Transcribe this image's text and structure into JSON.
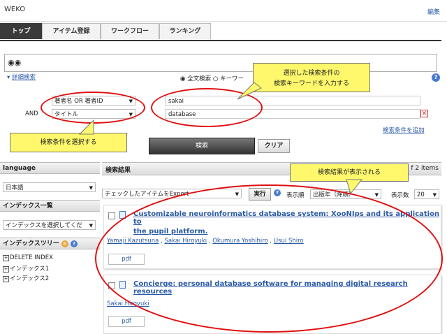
{
  "header": {
    "brand": "WEKO",
    "edit_link": "編集"
  },
  "tabs": [
    "トップ",
    "アイテム登録",
    "ワークフロー",
    "ランキング"
  ],
  "search": {
    "detail_link": "詳細検索",
    "mode_fulltext": "全文検索",
    "mode_keyword": "キーワー",
    "conditions": [
      {
        "field": "著者名 OR 著者ID",
        "value": "sakai"
      },
      {
        "operator": "AND",
        "field": "タイトル",
        "value": "database"
      }
    ],
    "add_condition": "検索条件を追加",
    "search_button": "検索",
    "clear_button": "クリア"
  },
  "sidebar": {
    "language_title": "language",
    "language_value": "日本語",
    "index_list_title": "インデックス一覧",
    "index_select_value": "インデックスを選択してくだ",
    "index_tree_title": "インデックスツリー",
    "tree": [
      "DELETE INDEX",
      "インデックス1",
      "インデックス2"
    ]
  },
  "results": {
    "title": "検索結果",
    "count_text": "f 2 items",
    "export_select": "チェックしたアイテムをExport",
    "run_button": "実行",
    "sort_label": "表示順",
    "sort_value": "出版年（降順）",
    "per_page_label": "表示数",
    "per_page_value": "20",
    "items": [
      {
        "title_line1": "Customizable neuroinformatics database system: XooNIps and its application to",
        "title_line2": "the pupil platform.",
        "authors": [
          "Yamaji Kazutsuna",
          "Sakai Hiroyuki",
          "Okumura Yoshihiro",
          "Usui Shiro"
        ],
        "file": "pdf"
      },
      {
        "title_line1": "Concierge: personal database software for managing digital research resources",
        "title_line2": "",
        "authors": [
          "Sakai Hiroyuki"
        ],
        "file": "pdf"
      }
    ]
  },
  "callouts": {
    "keyword_line1": "選択した検索条件の",
    "keyword_line2": "検索キーワードを入力する",
    "select_condition": "検索条件を選択する",
    "results_shown": "検索結果が表示される"
  },
  "colors": {
    "highlight_ring": "#e01010",
    "callout_bg": "#fff86c",
    "link": "#2a5aa6"
  }
}
